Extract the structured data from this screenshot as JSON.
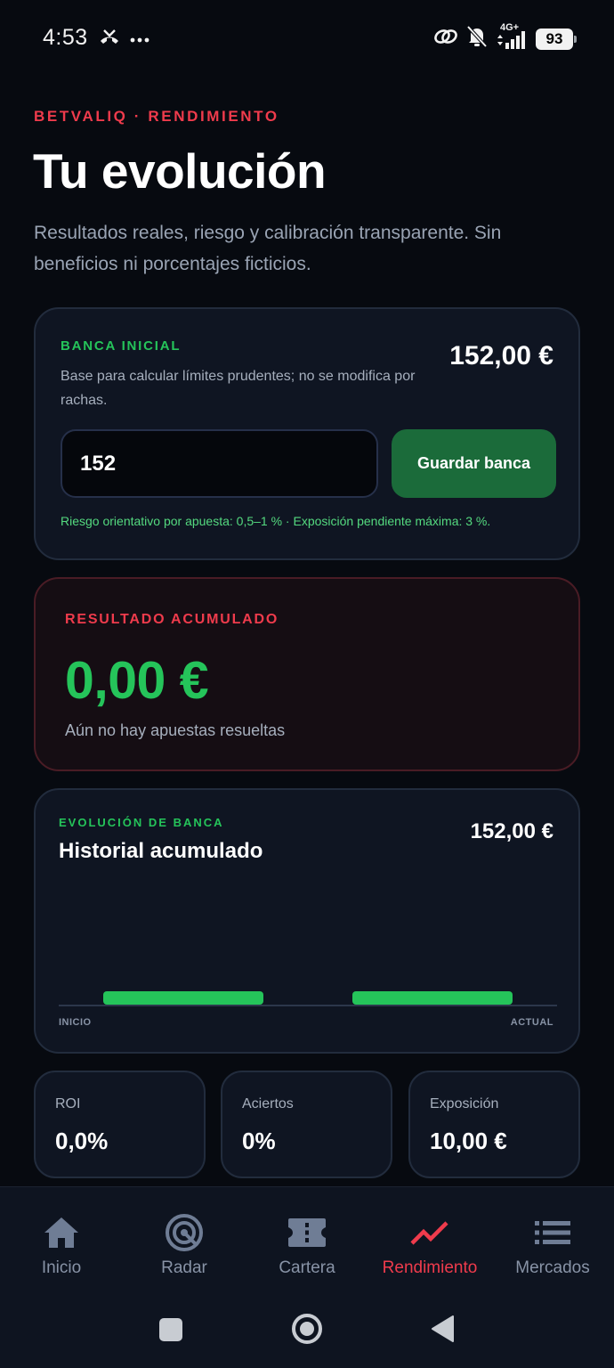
{
  "status_bar": {
    "time": "4:53",
    "network": "4G+",
    "battery": "93"
  },
  "header": {
    "eyebrow": "BETVALIQ · RENDIMIENTO",
    "title": "Tu evolución",
    "subtitle": "Resultados reales, riesgo y calibración transparente. Sin beneficios ni porcentajes ficticios."
  },
  "bank_card": {
    "label": "BANCA INICIAL",
    "amount": "152,00 €",
    "description": "Base para calcular límites prudentes; no se modifica por rachas.",
    "input_value": "152",
    "save_label": "Guardar banca",
    "risk_note": "Riesgo orientativo por apuesta: 0,5–1 % · Exposición pendiente máxima: 3 %."
  },
  "result_card": {
    "label": "RESULTADO ACUMULADO",
    "value": "0,00 €",
    "note": "Aún no hay apuestas resueltas"
  },
  "evolution_card": {
    "label": "EVOLUCIÓN DE BANCA",
    "title": "Historial acumulado",
    "amount": "152,00 €",
    "chart_data": {
      "type": "bar",
      "categories": [
        "INICIO",
        "ACTUAL"
      ],
      "values": [
        152,
        152
      ],
      "color": "#25c45a"
    }
  },
  "stats": [
    {
      "label": "ROI",
      "value": "0,0%"
    },
    {
      "label": "Aciertos",
      "value": "0%"
    },
    {
      "label": "Exposición",
      "value": "10,00 €"
    }
  ],
  "bottom_nav": {
    "items": [
      {
        "label": "Inicio",
        "icon": "home-icon"
      },
      {
        "label": "Radar",
        "icon": "radar-icon"
      },
      {
        "label": "Cartera",
        "icon": "ticket-icon"
      },
      {
        "label": "Rendimiento",
        "icon": "trend-icon",
        "active": true
      },
      {
        "label": "Mercados",
        "icon": "list-icon"
      }
    ]
  },
  "colors": {
    "accent_red": "#ef3b4c",
    "accent_green": "#25c45a",
    "button_green": "#1b6b3a",
    "background": "#070a10",
    "card": "#0f1522"
  }
}
